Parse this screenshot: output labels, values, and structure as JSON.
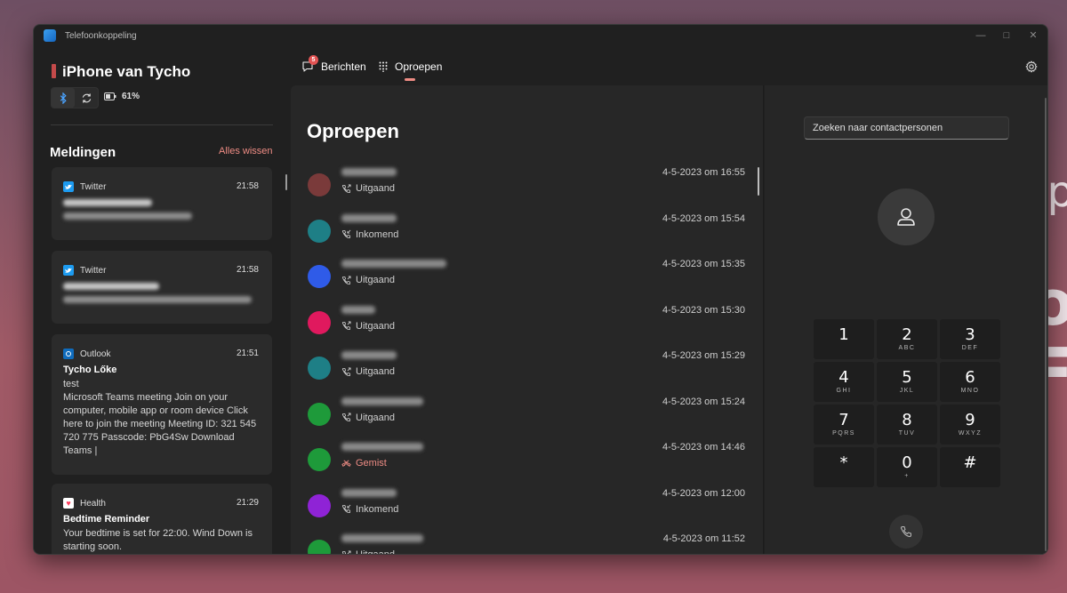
{
  "window": {
    "title": "Telefoonkoppeling"
  },
  "device": {
    "name": "iPhone van Tycho",
    "battery": "61%"
  },
  "sidebar": {
    "notifications_title": "Meldingen",
    "clear_all": "Alles wissen",
    "cards": [
      {
        "app": "Twitter",
        "time": "21:58"
      },
      {
        "app": "Twitter",
        "time": "21:58"
      },
      {
        "app": "Outlook",
        "time": "21:51",
        "title": "Tycho Lőke",
        "body": "test\nMicrosoft Teams meeting Join on your computer, mobile app or room device Click here to join the meeting Meeting ID: 321 545 720 775 Passcode: PbG4Sw Download Teams |"
      },
      {
        "app": "Health",
        "time": "21:29",
        "title": "Bedtime Reminder",
        "body": "Your bedtime is set for 22:00. Wind Down is starting soon."
      }
    ]
  },
  "nav": {
    "messages_label": "Berichten",
    "messages_badge": "5",
    "calls_label": "Oproepen"
  },
  "calls": {
    "heading": "Oproepen",
    "items": [
      {
        "type": "Uitgaand",
        "time": "4-5-2023 om 16:55",
        "color": "#7a3a3a",
        "missed": false
      },
      {
        "type": "Inkomend",
        "time": "4-5-2023 om 15:54",
        "color": "#1e7f86",
        "missed": false
      },
      {
        "type": "Uitgaand",
        "time": "4-5-2023 om 15:35",
        "color": "#2f5be8",
        "missed": false
      },
      {
        "type": "Uitgaand",
        "time": "4-5-2023 om 15:30",
        "color": "#e0195e",
        "missed": false
      },
      {
        "type": "Uitgaand",
        "time": "4-5-2023 om 15:29",
        "color": "#1e7f86",
        "missed": false
      },
      {
        "type": "Uitgaand",
        "time": "4-5-2023 om 15:24",
        "color": "#1e9a3a",
        "missed": false
      },
      {
        "type": "Gemist",
        "time": "4-5-2023 om 14:46",
        "color": "#1e9a3a",
        "missed": true
      },
      {
        "type": "Inkomend",
        "time": "4-5-2023 om 12:00",
        "color": "#8f23d6",
        "missed": false
      },
      {
        "type": "Uitgaand",
        "time": "4-5-2023 om 11:52",
        "color": "#1e9a3a",
        "missed": false
      }
    ]
  },
  "dialer": {
    "search_placeholder": "Zoeken naar contactpersonen",
    "keys": [
      {
        "num": "1",
        "sub": ""
      },
      {
        "num": "2",
        "sub": "ABC"
      },
      {
        "num": "3",
        "sub": "DEF"
      },
      {
        "num": "4",
        "sub": "GHI"
      },
      {
        "num": "5",
        "sub": "JKL"
      },
      {
        "num": "6",
        "sub": "MNO"
      },
      {
        "num": "7",
        "sub": "PQRS"
      },
      {
        "num": "8",
        "sub": "TUV"
      },
      {
        "num": "9",
        "sub": "WXYZ"
      },
      {
        "num": "*",
        "sub": ""
      },
      {
        "num": "0",
        "sub": "+"
      },
      {
        "num": "#",
        "sub": ""
      }
    ]
  },
  "colors": {
    "accent": "#ee8c84",
    "badge": "#e25353",
    "window_bg": "#202020",
    "panel_bg": "#272727"
  }
}
